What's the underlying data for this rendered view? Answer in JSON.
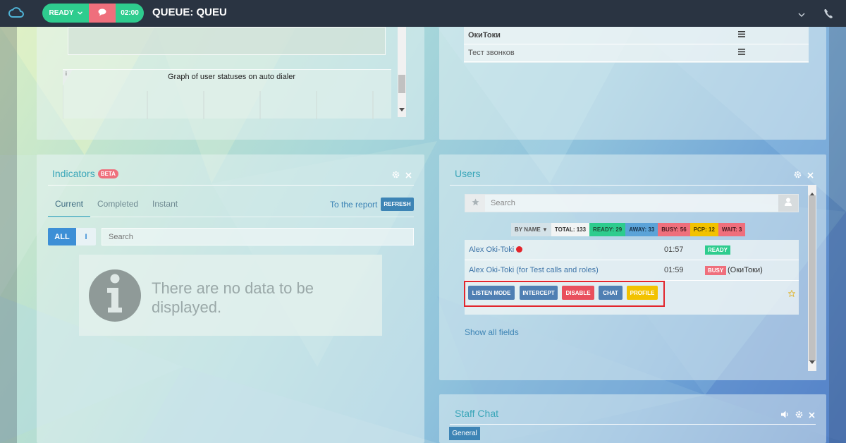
{
  "topbar": {
    "status_label": "READY",
    "timer": "02:00",
    "queue_title": "QUEUE: QUEU"
  },
  "graph_panel": {
    "graph_title": "Graph of user statuses on auto dialer",
    "info_symbol": "i"
  },
  "queue_list": {
    "rows": [
      "ОкиТоки",
      "Тест звонков"
    ]
  },
  "indicators": {
    "title": "Indicators",
    "beta_label": "BETA",
    "tabs": [
      "Current",
      "Completed",
      "Instant"
    ],
    "report_link": "To the report",
    "refresh_label": "REFRESH",
    "filter_all": "ALL",
    "filter_i": "I",
    "search_placeholder": "Search",
    "empty_message": "There are no data to be displayed."
  },
  "users": {
    "title": "Users",
    "search_placeholder": "Search",
    "sort_label": "BY NAME ▼",
    "stats": {
      "total": "TOTAL: 133",
      "ready": "READY: 29",
      "away": "AWAY: 33",
      "busy": "BUSY: 56",
      "pcp": "PCP: 12",
      "wait": "WAIT: 3"
    },
    "rows": [
      {
        "name": "Alex Oki-Toki",
        "time": "01:57",
        "status": "READY",
        "extra": ""
      },
      {
        "name": "Alex Oki-Toki (for Test calls and roles)",
        "time": "01:59",
        "status": "BUSY",
        "extra": "(ОкиТоки)"
      }
    ],
    "actions": {
      "listen": "LISTEN MODE",
      "intercept": "INTERCEPT",
      "disable": "DISABLE",
      "chat": "CHAT",
      "profile": "PROFILE"
    },
    "show_all": "Show all fields"
  },
  "staff_chat": {
    "title": "Staff Chat",
    "general_label": "General"
  },
  "colors": {
    "green": "#2ecc8e",
    "red": "#ef6f7c",
    "blue": "#3d84b5",
    "yellow": "#f2c200",
    "teal_title": "#3aa6b9"
  }
}
